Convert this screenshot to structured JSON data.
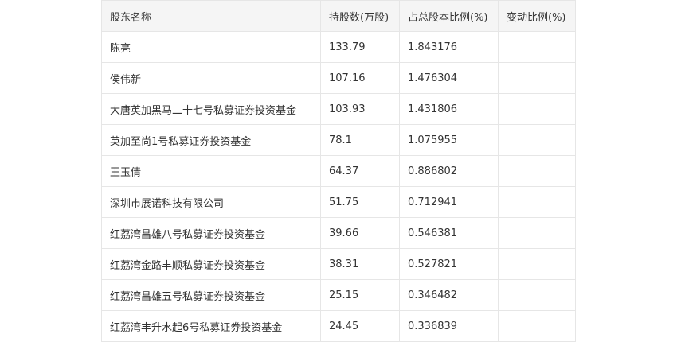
{
  "table": {
    "headers": [
      "股东名称",
      "持股数(万股)",
      "占总股本比例(%)",
      "变动比例(%)"
    ],
    "rows": [
      [
        "陈亮",
        "133.79",
        "1.843176",
        ""
      ],
      [
        "侯伟新",
        "107.16",
        "1.476304",
        ""
      ],
      [
        "大唐英加黑马二十七号私募证券投资基金",
        "103.93",
        "1.431806",
        ""
      ],
      [
        "英加至尚1号私募证券投资基金",
        "78.1",
        "1.075955",
        ""
      ],
      [
        "王玉倩",
        "64.37",
        "0.886802",
        ""
      ],
      [
        "深圳市展诺科技有限公司",
        "51.75",
        "0.712941",
        ""
      ],
      [
        "红荔湾昌雄八号私募证券投资基金",
        "39.66",
        "0.546381",
        ""
      ],
      [
        "红荔湾金路丰顺私募证券投资基金",
        "38.31",
        "0.527821",
        ""
      ],
      [
        "红荔湾昌雄五号私募证券投资基金",
        "25.15",
        "0.346482",
        ""
      ],
      [
        "红荔湾丰升水起6号私募证券投资基金",
        "24.45",
        "0.336839",
        ""
      ]
    ]
  }
}
